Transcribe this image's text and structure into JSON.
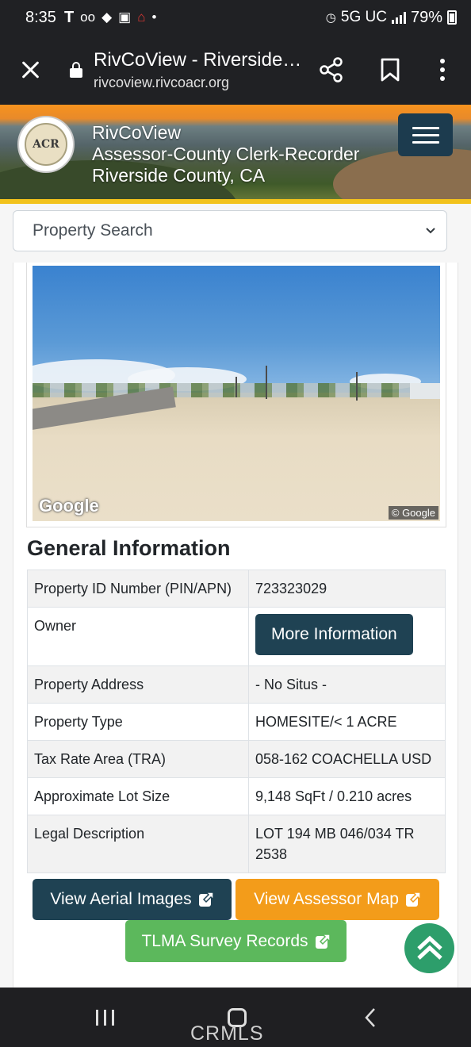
{
  "status_bar": {
    "time": "8:35",
    "icons": [
      "tmobile-icon",
      "voicemail-icon",
      "app-notification-icon",
      "photo-icon",
      "home-app-icon",
      "dot-icon"
    ],
    "network": "5G UC",
    "battery": "79%"
  },
  "browser": {
    "title": "RivCoView - Riverside…",
    "url": "rivcoview.rivcoacr.org"
  },
  "header": {
    "logo_text": "ACR",
    "line1": "RivCoView",
    "line2": "Assessor-County Clerk-Recorder",
    "line3": "Riverside County, CA"
  },
  "search": {
    "selected": "Property Search"
  },
  "photo": {
    "google_logo": "Google",
    "copyright": "© Google"
  },
  "general": {
    "title": "General Information",
    "rows": [
      {
        "label": "Property ID Number (PIN/APN)",
        "value": "723323029"
      },
      {
        "label": "Owner",
        "value": "More Information"
      },
      {
        "label": "Property Address",
        "value": "- No Situs -"
      },
      {
        "label": "Property Type",
        "value": "HOMESITE/< 1 ACRE"
      },
      {
        "label": "Tax Rate Area (TRA)",
        "value": "058-162 COACHELLA USD"
      },
      {
        "label": "Approximate Lot Size",
        "value": "9,148 SqFt / 0.210 acres"
      },
      {
        "label": "Legal Description",
        "value": "LOT 194 MB 046/034 TR 2538"
      }
    ]
  },
  "buttons": {
    "aerial": "View Aerial Images",
    "assessor": "View Assessor Map",
    "tlma": "TLMA Survey Records"
  },
  "colors": {
    "dark_teal": "#1f4253",
    "orange": "#f39c1a",
    "green": "#5cb85c",
    "scroll_top": "#2d9e6b"
  },
  "watermark": "CRMLS"
}
